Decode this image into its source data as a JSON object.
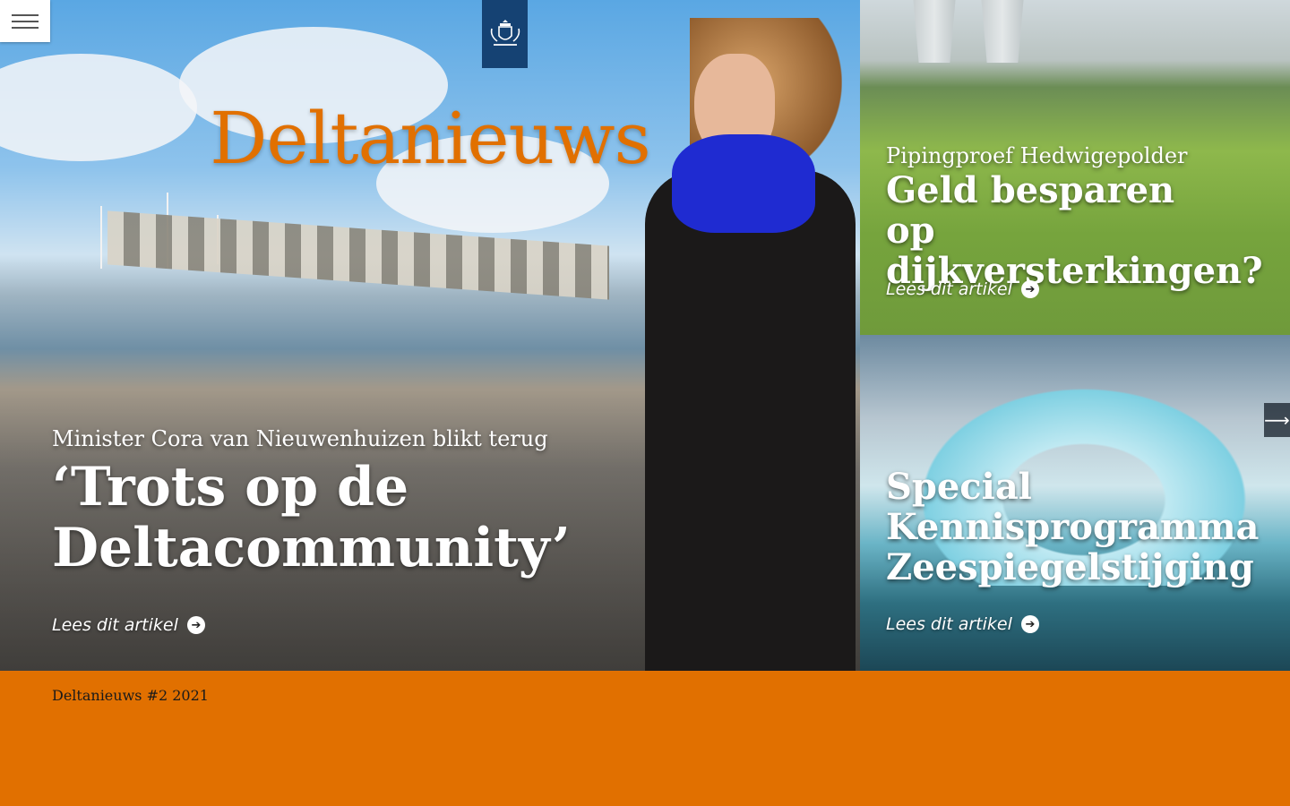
{
  "header": {
    "menu_icon": "hamburger-menu-icon",
    "logo_icon": "rijksoverheid-coat-of-arms-icon",
    "brand": "Deltanieuws"
  },
  "hero": {
    "kicker": "Minister Cora van Nieuwenhuizen blikt terug",
    "title": "‘Trots op de Deltacommunity’",
    "read_more": "Lees dit artikel"
  },
  "tiles": [
    {
      "kicker": "Pipingproef Hedwigepolder",
      "title": "Geld besparen op dijkversterkingen?",
      "read_more": "Lees dit artikel"
    },
    {
      "kicker": "",
      "title": "Special Kennisprogramma Zeespiegelstijging",
      "read_more": "Lees dit artikel"
    }
  ],
  "next_icon": "arrow-right-icon",
  "footer": {
    "issue": "Deltanieuws #2 2021"
  },
  "colors": {
    "accent": "#e17000",
    "logo_blue": "#154273"
  }
}
